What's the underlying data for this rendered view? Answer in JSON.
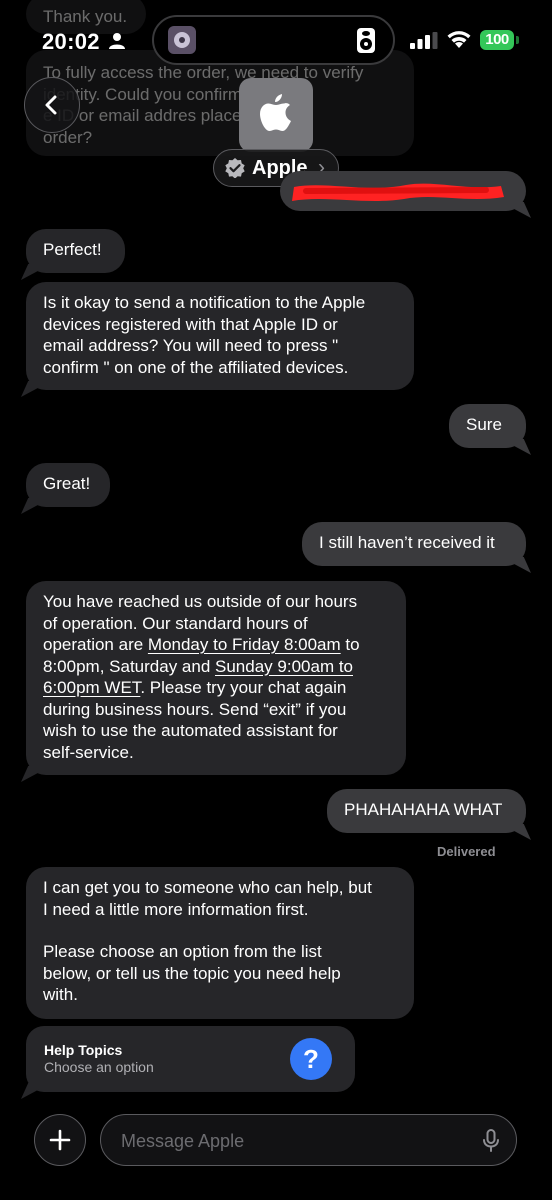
{
  "status_bar": {
    "time": "20:02",
    "battery": "100"
  },
  "header": {
    "contact_name": "Apple",
    "chevron": "›"
  },
  "faded_top": {
    "msg1": "Thank you.",
    "msg2_l1": "To fully access the order, we need to verify",
    "msg2_l2": "identity.  Could you   confirm the",
    "msg2_l3": "e ID or email addres   place the",
    "msg2_l4": "order?"
  },
  "messages": {
    "m1": "Perfect!",
    "m2_l1": "Is it okay to send a notification to the Apple",
    "m2_l2": "devices registered with that Apple ID or",
    "m2_l3": "email address? You will need to press \"",
    "m2_l4": "confirm \" on one of the affiliated devices.",
    "m3": "Sure",
    "m4": "Great!",
    "m5": "I still haven’t received it",
    "m6_l1": "You have reached us outside of our hours",
    "m6_l2": "of operation. Our standard hours of",
    "m6_l3a": "operation are ",
    "m6_l3b": "Monday to Friday 8:00am",
    "m6_l3c": " to",
    "m6_l4a": "8:00pm, Saturday and ",
    "m6_l4b": "Sunday 9:00am to",
    "m6_l5a": "6:00pm WET",
    "m6_l5b": ". Please try your chat again",
    "m6_l6": "during business hours. Send “exit” if you",
    "m6_l7": "wish to use the automated assistant for",
    "m6_l8": "self-service.",
    "m7": "PHAHAHAHA WHAT",
    "delivered": "Delivered",
    "m8_l1": "I can get you to someone who can help, but",
    "m8_l2": "I need a little more information first.",
    "m8_l3": "Please choose an option from the list",
    "m8_l4": "below, or tell us the topic you need help",
    "m8_l5": "with."
  },
  "help_topics": {
    "title": "Help Topics",
    "subtitle": "Choose an option",
    "icon": "?"
  },
  "composer": {
    "placeholder": "Message Apple"
  }
}
